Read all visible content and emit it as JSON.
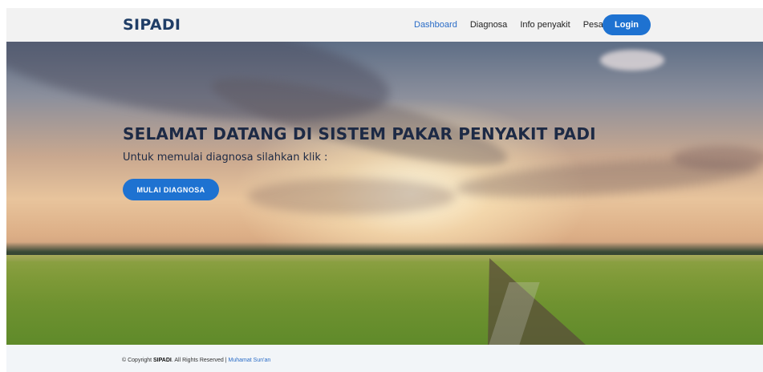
{
  "navbar": {
    "brand": "SIPADI",
    "links": [
      {
        "label": "Dashboard",
        "active": true
      },
      {
        "label": "Diagnosa",
        "active": false
      },
      {
        "label": "Info penyakit",
        "active": false
      },
      {
        "label": "Pesan",
        "active": false
      }
    ],
    "login_label": "Login"
  },
  "hero": {
    "title": "SELAMAT DATANG DI SISTEM PAKAR PENYAKIT PADI",
    "subtitle": "Untuk memulai diagnosa silahkan klik :",
    "cta_label": "MULAI DIAGNOSA"
  },
  "footer": {
    "copyright_prefix": "© Copyright ",
    "brand": "SIPADI",
    "rights": ". All Rights Reserved |",
    "author_link": "Muhamat Sun'an"
  },
  "colors": {
    "primary": "#1e72d1",
    "brand_text": "#1f3d66",
    "navbar_bg": "#f2f2f2",
    "footer_bg": "#f2f5f8"
  }
}
